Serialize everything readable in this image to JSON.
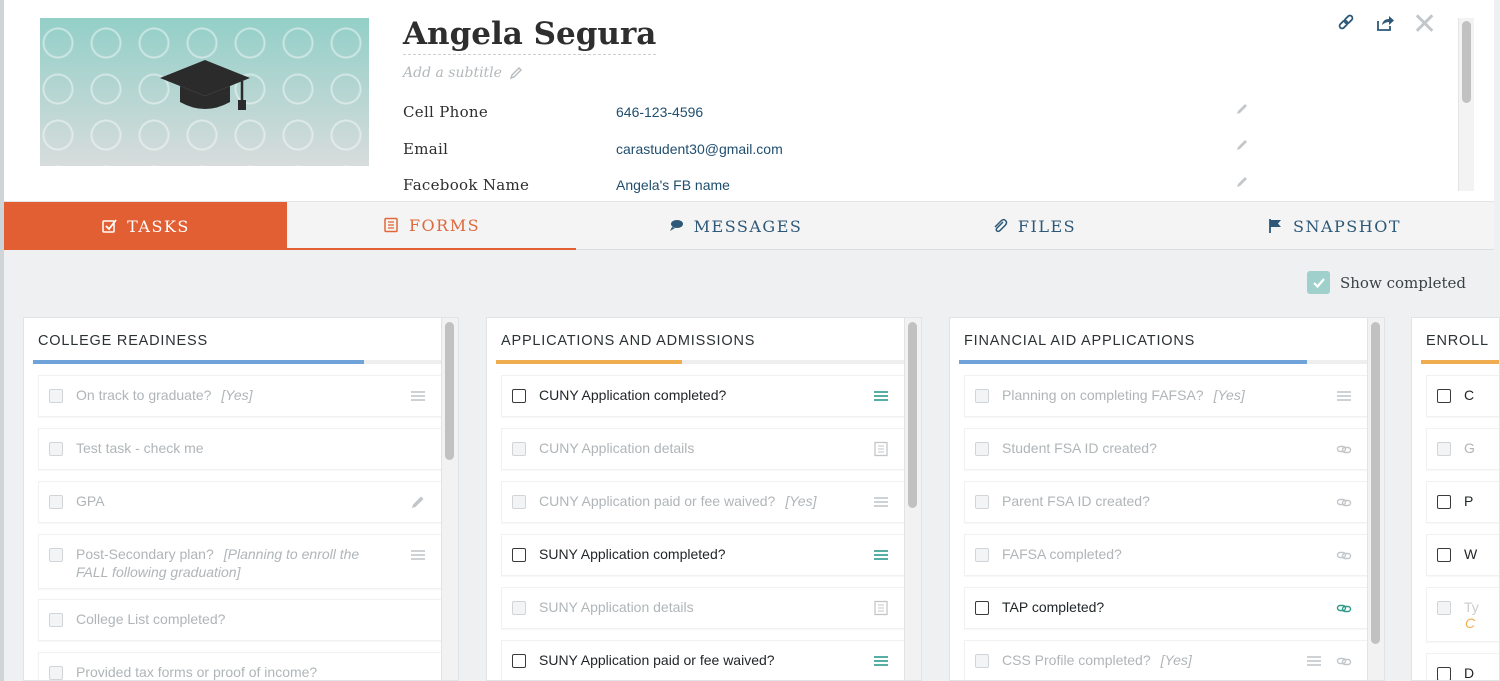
{
  "contact": {
    "name": "Angela Segura",
    "subtitle_placeholder": "Add a subtitle",
    "fields": [
      {
        "label": "Cell Phone",
        "value": "646-123-4596"
      },
      {
        "label": "Email",
        "value": "carastudent30@gmail.com"
      },
      {
        "label": "Facebook Name",
        "value": "Angela's FB name"
      }
    ]
  },
  "header_icons": [
    "link-icon",
    "share-icon",
    "close-icon"
  ],
  "close_glyph": "✕",
  "tabs": [
    {
      "label": "TASKS",
      "icon": "check-square-icon",
      "active": true
    },
    {
      "label": "FORMS",
      "icon": "form-icon"
    },
    {
      "label": "MESSAGES",
      "icon": "chat-icon"
    },
    {
      "label": "FILES",
      "icon": "paperclip-icon"
    },
    {
      "label": "SNAPSHOT",
      "icon": "flag-icon"
    }
  ],
  "toolbar": {
    "show_completed_label": "Show completed",
    "show_completed": true
  },
  "colors": {
    "accent": "#e25f33",
    "progress_blue": "#6fa3d9",
    "progress_orange": "#efad4f",
    "icon_teal": "#2d9a8a"
  },
  "columns": [
    {
      "title": "COLLEGE READINESS",
      "progress_color": "blue",
      "progress": 0.8,
      "tasks": [
        {
          "label": "On track to graduate?",
          "note": "[Yes]",
          "done": true,
          "icon": "list-icon"
        },
        {
          "label": "Test task - check me",
          "done": true
        },
        {
          "label": "GPA",
          "done": true,
          "icon": "pencil-icon"
        },
        {
          "label": "Post-Secondary plan?",
          "note": "[Planning to enroll the FALL following graduation]",
          "done": true,
          "icon": "list-icon"
        },
        {
          "label": "College List completed?",
          "done": true
        },
        {
          "label": "Provided tax forms or proof of income?",
          "done": true
        }
      ]
    },
    {
      "title": "APPLICATIONS AND ADMISSIONS",
      "progress_color": "orange",
      "progress": 0.45,
      "tasks": [
        {
          "label": "CUNY Application completed?",
          "done": false,
          "icon": "list-icon"
        },
        {
          "label": "CUNY Application details",
          "done": true,
          "icon": "form-icon"
        },
        {
          "label": "CUNY Application paid or fee waived?",
          "note": "[Yes]",
          "done": true,
          "icon": "list-icon"
        },
        {
          "label": "SUNY Application completed?",
          "done": false,
          "icon": "list-icon"
        },
        {
          "label": "SUNY Application details",
          "done": true,
          "icon": "form-icon"
        },
        {
          "label": "SUNY Application paid or fee waived?",
          "done": false,
          "icon": "list-icon"
        }
      ]
    },
    {
      "title": "FINANCIAL AID APPLICATIONS",
      "progress_color": "blue",
      "progress": 0.84,
      "tasks": [
        {
          "label": "Planning on completing FAFSA?",
          "note": "[Yes]",
          "done": true,
          "icon": "list-icon"
        },
        {
          "label": "Student FSA ID created?",
          "done": true,
          "icon": "link-icon"
        },
        {
          "label": "Parent FSA ID created?",
          "done": true,
          "icon": "link-icon"
        },
        {
          "label": "FAFSA completed?",
          "done": true,
          "icon": "link-icon"
        },
        {
          "label": "TAP completed?",
          "done": false,
          "icon": "link-icon"
        },
        {
          "label": "CSS Profile completed?",
          "note": "[Yes]",
          "done": true,
          "icon": "link-icon"
        }
      ]
    },
    {
      "title": "ENROLL",
      "partial_labels": [
        "C",
        "G",
        "P",
        "W",
        "Ty",
        "C",
        "D"
      ]
    }
  ]
}
